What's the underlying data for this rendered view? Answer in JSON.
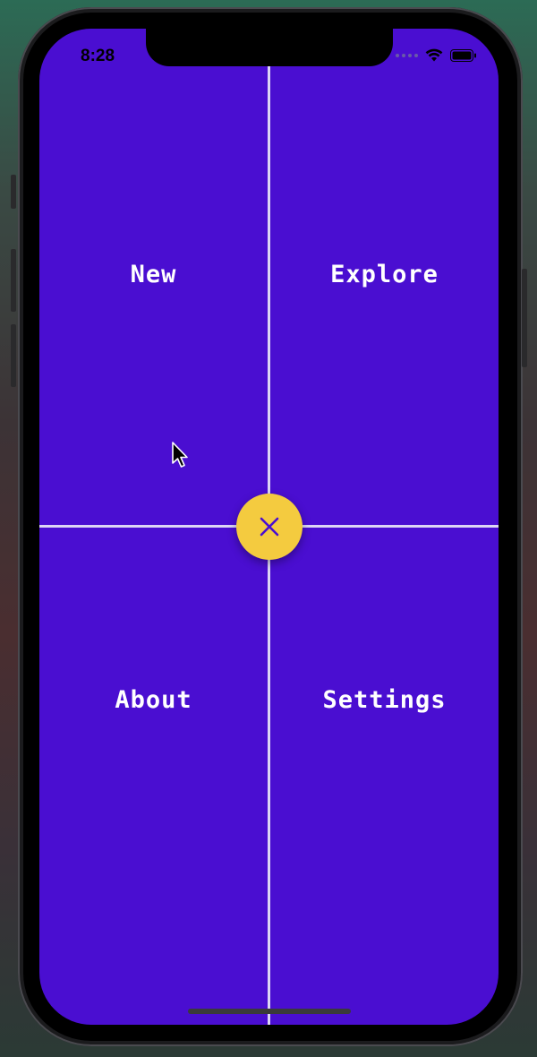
{
  "status_bar": {
    "time": "8:28"
  },
  "menu": {
    "items": [
      {
        "id": "new",
        "label": "New"
      },
      {
        "id": "explore",
        "label": "Explore"
      },
      {
        "id": "about",
        "label": "About"
      },
      {
        "id": "settings",
        "label": "Settings"
      }
    ]
  },
  "fab": {
    "icon": "close-icon"
  },
  "colors": {
    "background": "#4a0ed1",
    "fab": "#f4cb3f",
    "divider": "#ddd6f5",
    "label": "#ffffff",
    "fab_icon": "#4a0ed1"
  }
}
